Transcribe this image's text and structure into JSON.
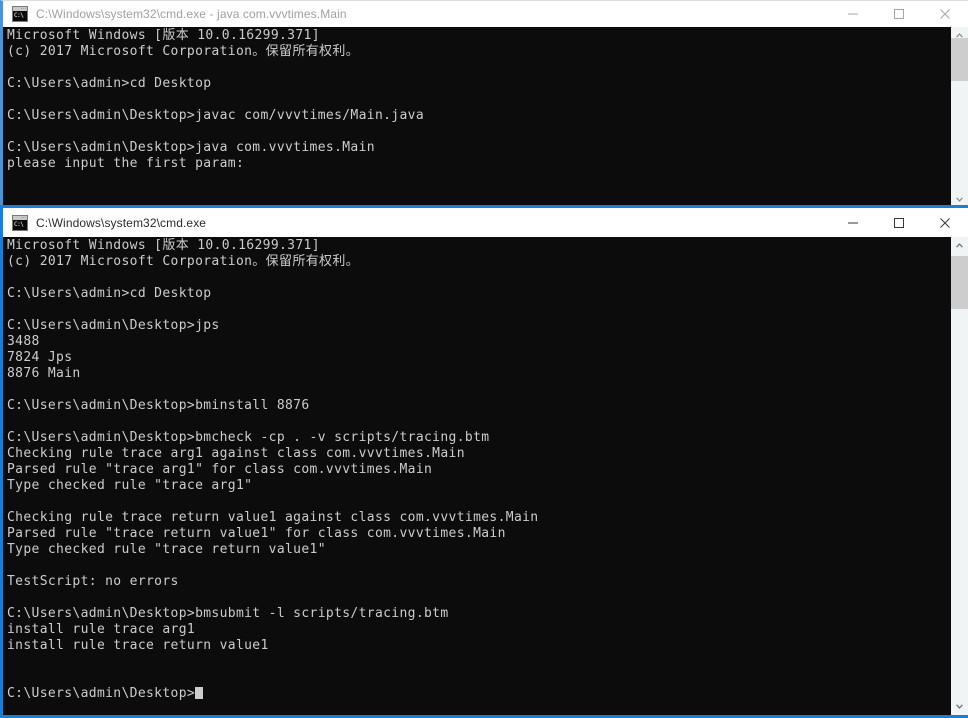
{
  "windows": [
    {
      "id": "back",
      "state": "inactive",
      "icon": "cmd-console-icon",
      "title": "C:\\Windows\\system32\\cmd.exe - java  com.vvvtimes.Main",
      "controls": {
        "minimize_label": "Minimize",
        "maximize_label": "Maximize",
        "close_label": "Close"
      },
      "terminal_lines": [
        "Microsoft Windows [版本 10.0.16299.371]",
        "(c) 2017 Microsoft Corporation。保留所有权利。",
        "",
        "C:\\Users\\admin>cd Desktop",
        "",
        "C:\\Users\\admin\\Desktop>javac com/vvvtimes/Main.java",
        "",
        "C:\\Users\\admin\\Desktop>java com.vvvtimes.Main",
        "please input the first param:"
      ],
      "cursor_visible": false,
      "scrollbar": {
        "visible": true,
        "thumb_top_pct": 6,
        "thumb_height_pct": 24,
        "up_arrow": "scroll-up-arrow-icon",
        "down_arrow": "scroll-down-arrow-icon"
      }
    },
    {
      "id": "front",
      "state": "active",
      "icon": "cmd-console-icon",
      "title": "C:\\Windows\\system32\\cmd.exe",
      "controls": {
        "minimize_label": "Minimize",
        "maximize_label": "Maximize",
        "close_label": "Close"
      },
      "terminal_lines": [
        "Microsoft Windows [版本 10.0.16299.371]",
        "(c) 2017 Microsoft Corporation。保留所有权利。",
        "",
        "C:\\Users\\admin>cd Desktop",
        "",
        "C:\\Users\\admin\\Desktop>jps",
        "3488",
        "7824 Jps",
        "8876 Main",
        "",
        "C:\\Users\\admin\\Desktop>bminstall 8876",
        "",
        "C:\\Users\\admin\\Desktop>bmcheck -cp . -v scripts/tracing.btm",
        "Checking rule trace arg1 against class com.vvvtimes.Main",
        "Parsed rule \"trace arg1\" for class com.vvvtimes.Main",
        "Type checked rule \"trace arg1\"",
        "",
        "Checking rule trace return value1 against class com.vvvtimes.Main",
        "Parsed rule \"trace return value1\" for class com.vvvtimes.Main",
        "Type checked rule \"trace return value1\"",
        "",
        "TestScript: no errors",
        "",
        "C:\\Users\\admin\\Desktop>bmsubmit -l scripts/tracing.btm",
        "install rule trace arg1",
        "install rule trace return value1",
        "",
        "",
        "C:\\Users\\admin\\Desktop>"
      ],
      "cursor_visible": true,
      "scrollbar": {
        "visible": true,
        "thumb_top_pct": 4,
        "thumb_height_pct": 11,
        "up_arrow": "scroll-up-arrow-icon",
        "down_arrow": "scroll-down-arrow-icon"
      }
    }
  ],
  "colors": {
    "console_background": "#0c0c0c",
    "console_foreground": "#cccccc",
    "active_accent": "#1a7fd4",
    "inactive_accent": "#4a93d9",
    "titlebar_background": "#ffffff",
    "scrollbar_track": "#f0f4f4",
    "scrollbar_thumb": "#cdcdcd"
  }
}
